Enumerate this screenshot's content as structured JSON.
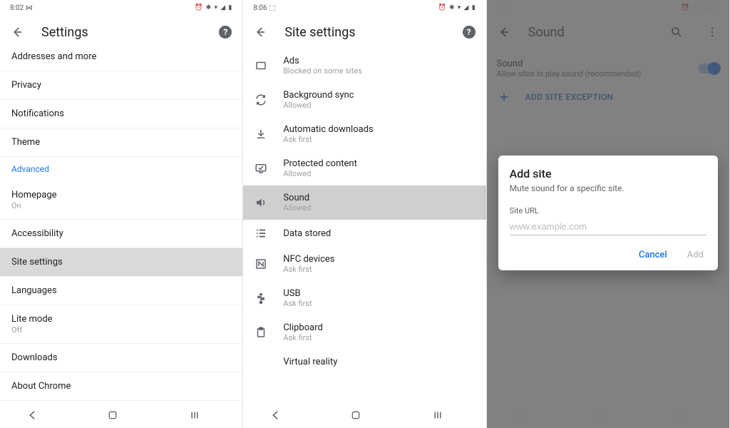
{
  "panel1": {
    "status": {
      "time": "8:02 ⋈",
      "icons": "⏰ ✱ ▾ ◢ ▮"
    },
    "title": "Settings",
    "items": [
      {
        "primary": "Addresses and more",
        "secondary": "",
        "truncated_top": true
      },
      {
        "primary": "Privacy",
        "secondary": ""
      },
      {
        "primary": "Notifications",
        "secondary": ""
      },
      {
        "primary": "Theme",
        "secondary": ""
      },
      {
        "primary": "Advanced",
        "section": true
      },
      {
        "primary": "Homepage",
        "secondary": "On"
      },
      {
        "primary": "Accessibility",
        "secondary": ""
      },
      {
        "primary": "Site settings",
        "secondary": "",
        "highlight": true
      },
      {
        "primary": "Languages",
        "secondary": ""
      },
      {
        "primary": "Lite mode",
        "secondary": "Off"
      },
      {
        "primary": "Downloads",
        "secondary": ""
      },
      {
        "primary": "About Chrome",
        "secondary": ""
      }
    ]
  },
  "panel2": {
    "status": {
      "time": "8:06 ⬚",
      "icons": "⏰ ✱ ▾ ◢ ▮"
    },
    "title": "Site settings",
    "items": [
      {
        "icon": "rect",
        "primary": "Ads",
        "secondary": "Blocked on some sites"
      },
      {
        "icon": "sync",
        "primary": "Background sync",
        "secondary": "Allowed"
      },
      {
        "icon": "download",
        "primary": "Automatic downloads",
        "secondary": "Ask first"
      },
      {
        "icon": "tv-check",
        "primary": "Protected content",
        "secondary": "Allowed"
      },
      {
        "icon": "volume",
        "primary": "Sound",
        "secondary": "Allowed",
        "highlight": true
      },
      {
        "icon": "list",
        "primary": "Data stored",
        "secondary": ""
      },
      {
        "icon": "nfc",
        "primary": "NFC devices",
        "secondary": "Ask first"
      },
      {
        "icon": "usb",
        "primary": "USB",
        "secondary": "Ask first"
      },
      {
        "icon": "clipboard",
        "primary": "Clipboard",
        "secondary": "Ask first"
      },
      {
        "icon": "",
        "primary": "Virtual reality",
        "secondary": ""
      }
    ]
  },
  "panel3": {
    "status": {
      "time": "8:05",
      "icons": "⏰ ✱ ▾ ◢ ▮"
    },
    "title": "Sound",
    "sound": {
      "primary": "Sound",
      "secondary": "Allow sites to play sound (recommended)"
    },
    "add_exception": "ADD SITE EXCEPTION",
    "dialog": {
      "title": "Add site",
      "subtitle": "Mute sound for a specific site.",
      "field_label": "Site URL",
      "placeholder": "www.example.com",
      "cancel": "Cancel",
      "add": "Add"
    }
  }
}
